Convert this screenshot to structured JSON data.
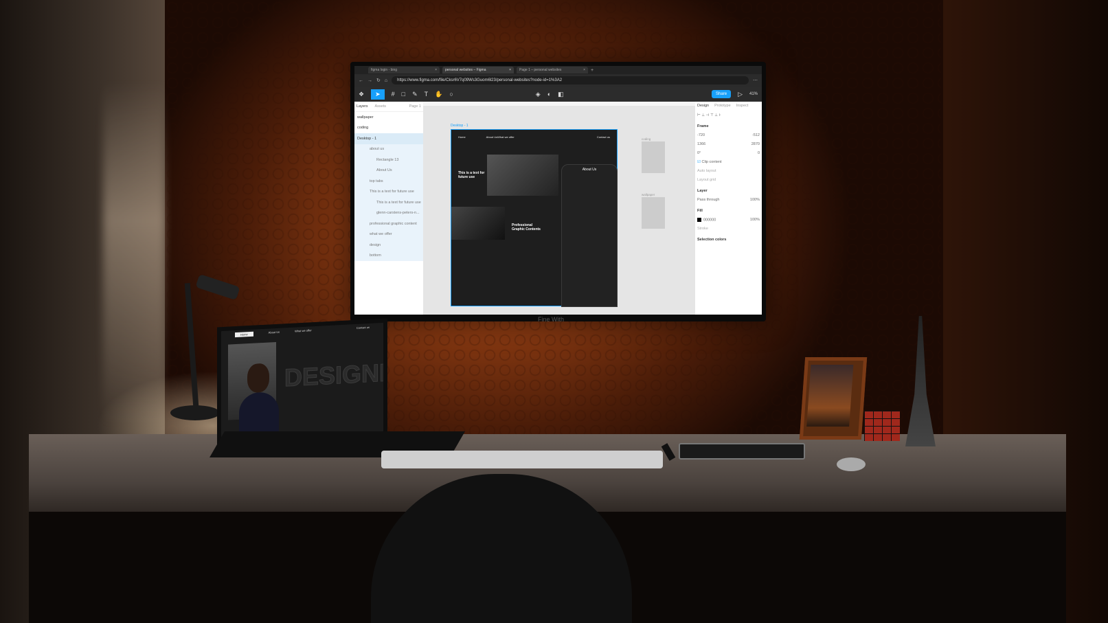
{
  "browser": {
    "tabs": [
      {
        "label": "figma login - bing"
      },
      {
        "label": "personal websites – Figma"
      },
      {
        "label": "Page 1 – personal websites"
      }
    ],
    "url": "https://www.figma.com/file/Cksr6V7q09Ws3Guom6l23/personal-websites?node-id=1%3A2"
  },
  "figma": {
    "share_label": "Share",
    "zoom": "41%",
    "layers_tab": "Layers",
    "assets_tab": "Assets",
    "page": "Page 1",
    "layers": [
      {
        "label": "wallpaper"
      },
      {
        "label": "coding"
      },
      {
        "label": "Desktop - 1"
      },
      {
        "label": "about us"
      },
      {
        "label": "Rectangle 13"
      },
      {
        "label": "About Us"
      },
      {
        "label": "top tabs"
      },
      {
        "label": "This is a text for future use"
      },
      {
        "label": "This is a text for future use"
      },
      {
        "label": "glenn-carstens-peters-n..."
      },
      {
        "label": "professional graphic content"
      },
      {
        "label": "what we offer"
      },
      {
        "label": "design"
      },
      {
        "label": "bottom"
      }
    ],
    "frame_label": "Desktop - 1",
    "frame_nav": {
      "home": "Home",
      "about": "About Us",
      "offer": "What we offer",
      "contact": "Contact us"
    },
    "hero_text": "This is a text for future use",
    "prof_text": "Professional Graphic Contents",
    "phone_title": "About Us",
    "side_frames": [
      {
        "label": "coding"
      },
      {
        "label": "wallpaper"
      }
    ],
    "props": {
      "tabs": [
        "Design",
        "Prototype",
        "Inspect"
      ],
      "frame": "Frame",
      "x": "-720",
      "y": "-512",
      "w": "1366",
      "h": "2870",
      "rotation": "0°",
      "radius": "0",
      "clip": "Clip content",
      "auto_layout": "Auto layout",
      "layout_grid": "Layout grid",
      "layer": "Layer",
      "pass_through": "Pass through",
      "opacity": "100%",
      "fill": "Fill",
      "fill_hex": "000000",
      "fill_opacity": "100%",
      "stroke": "Stroke",
      "selection_colors": "Selection colors"
    }
  },
  "monitor_caption": "Fine With",
  "laptop": {
    "nav": {
      "home": "Home",
      "about": "About Us",
      "offer": "What we offer",
      "contact": "Contact us"
    },
    "word": "DESIGNERS"
  }
}
